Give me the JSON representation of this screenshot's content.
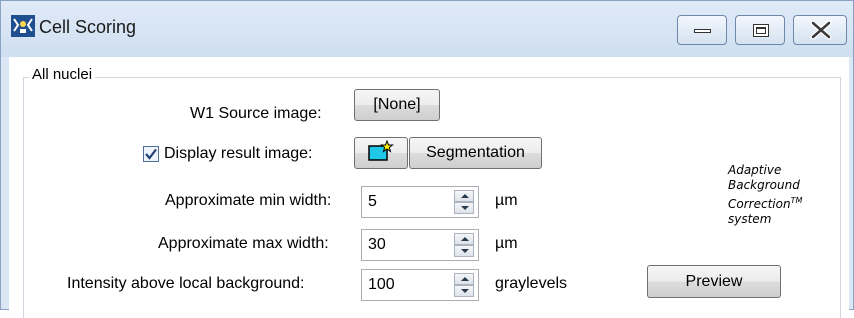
{
  "window": {
    "title": "Cell Scoring",
    "icons": {
      "app": "cell-scoring-app-icon",
      "minimize": "minimize-icon",
      "maximize": "maximize-icon",
      "close": "close-icon"
    }
  },
  "group": {
    "title": "All nuclei"
  },
  "source": {
    "label": "W1 Source image:",
    "button": "[None]"
  },
  "display": {
    "label": "Display result image:",
    "checked": true,
    "icon": "new-image-icon",
    "button": "Segmentation"
  },
  "min_width": {
    "label": "Approximate min width:",
    "value": "5",
    "unit": "µm"
  },
  "max_width": {
    "label": "Approximate max width:",
    "value": "30",
    "unit": "µm"
  },
  "intensity": {
    "label": "Intensity above local background:",
    "value": "100",
    "unit": "graylevels"
  },
  "preview": {
    "button": "Preview"
  },
  "abc": {
    "line1": "Adaptive",
    "line2": "Background",
    "line3": "Correction",
    "tm": "TM",
    "line4": "system"
  },
  "colors": {
    "title_bar": "#dbe7f5",
    "new_image_icon": "#1ec8e6"
  }
}
